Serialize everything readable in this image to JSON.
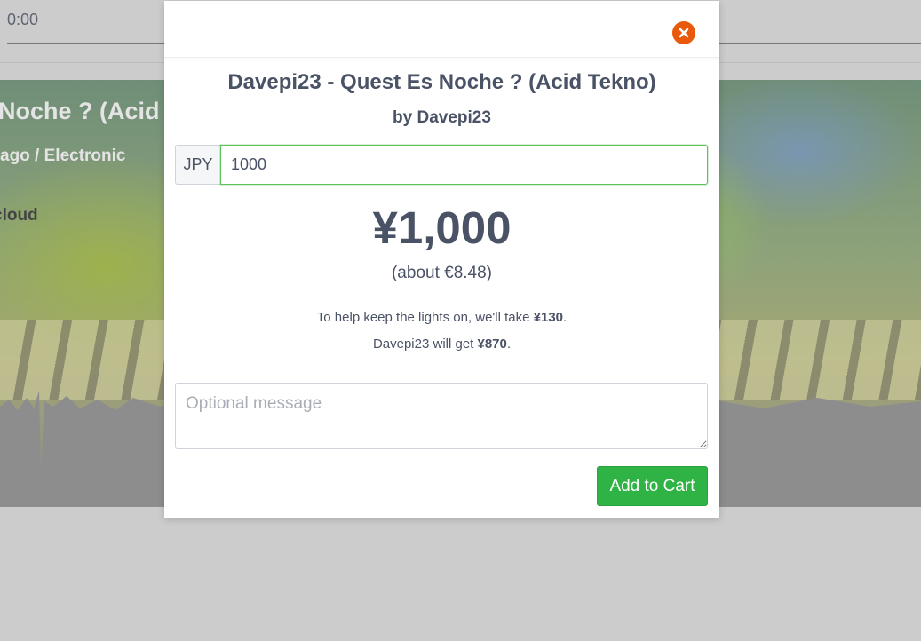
{
  "background": {
    "player": {
      "time": "0:00"
    },
    "hero": {
      "title_fragment": "Noche ? (Acid",
      "meta_fragment": "ago / Electronic",
      "source_fragment": "cloud"
    }
  },
  "modal": {
    "title": "Davepi23 - Quest Es Noche ? (Acid Tekno)",
    "artist_line": "by Davepi23",
    "currency_code": "JPY",
    "amount_value": "1000",
    "price_display": "¥1,000",
    "price_approx": "(about €8.48)",
    "fee_line_1": {
      "prefix": "To help keep the lights on, we'll take ",
      "amount": "¥130",
      "suffix": "."
    },
    "fee_line_2": {
      "prefix": "Davepi23 will get ",
      "amount": "¥870",
      "suffix": "."
    },
    "message_placeholder": "Optional message",
    "add_to_cart_label": "Add to Cart",
    "icons": {
      "close": "close-icon"
    },
    "colors": {
      "accent_green": "#2fb344",
      "close_orange": "#e8590c",
      "text": "#4a5265"
    }
  }
}
